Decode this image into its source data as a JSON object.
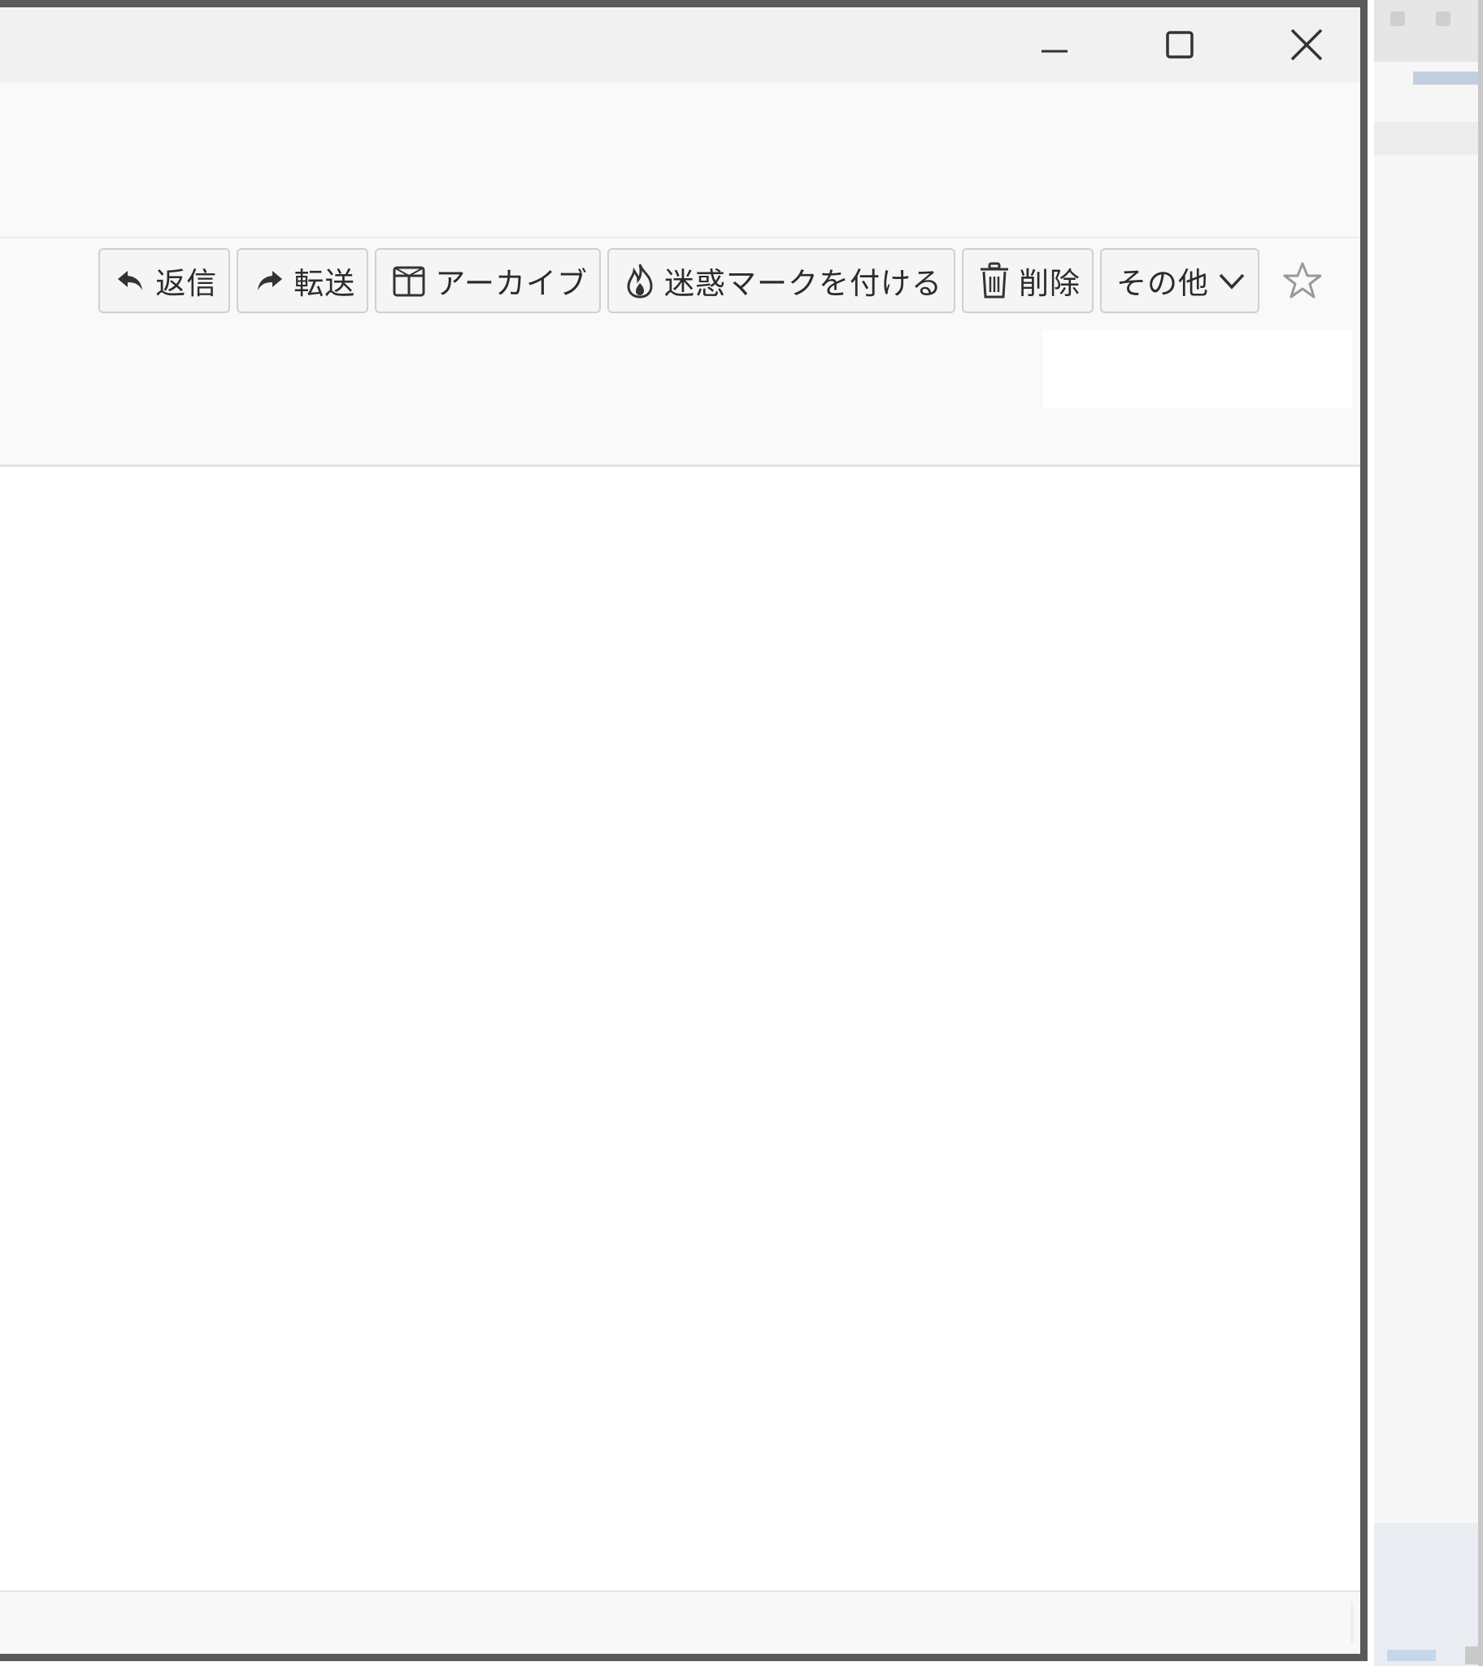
{
  "window_controls": {
    "minimize_icon": "minimize-icon",
    "maximize_icon": "maximize-icon",
    "close_icon": "close-icon"
  },
  "toolbar": {
    "reply_label": "返信",
    "forward_label": "転送",
    "archive_label": "アーカイブ",
    "junk_label": "迷惑マークを付ける",
    "delete_label": "削除",
    "more_label": "その他",
    "star_icon": "star-icon"
  },
  "colors": {
    "window_border": "#5a5a5a",
    "titlebar_bg": "#f1f1f1",
    "header_bg": "#f9f9f9",
    "button_border": "#d0d0d0",
    "text": "#2b2b2b"
  }
}
